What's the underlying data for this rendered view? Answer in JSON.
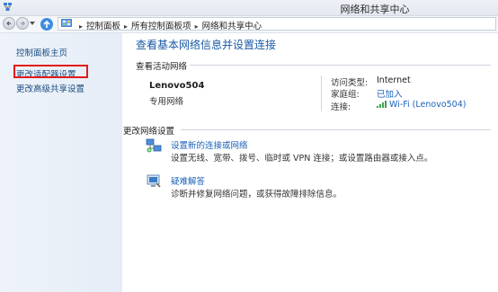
{
  "window": {
    "title": "网络和共享中心"
  },
  "breadcrumb": {
    "items": [
      "控制面板",
      "所有控制面板项",
      "网络和共享中心"
    ]
  },
  "sidebar": {
    "items": [
      {
        "label": "控制面板主页"
      },
      {
        "label": "更改适配器设置"
      },
      {
        "label": "更改高级共享设置"
      }
    ]
  },
  "main": {
    "title": "查看基本网络信息并设置连接",
    "active_networks_label": "查看活动网络",
    "network": {
      "name": "Lenovo504",
      "type": "专用网络",
      "access_type_label": "访问类型:",
      "access_type_value": "Internet",
      "homegroup_label": "家庭组:",
      "homegroup_value": "已加入",
      "connection_label": "连接:",
      "connection_value": "Wi-Fi (Lenovo504)"
    },
    "change_settings_label": "更改网络设置",
    "tasks": [
      {
        "link": "设置新的连接或网络",
        "desc": "设置无线、宽带、拨号、临时或 VPN 连接；或设置路由器或接入点。",
        "icon": "new-connection-icon"
      },
      {
        "link": "疑难解答",
        "desc": "诊断并修复网络问题，或获得故障排除信息。",
        "icon": "troubleshoot-icon"
      }
    ]
  },
  "colors": {
    "link": "#1a62b8",
    "title": "#1a5aa5",
    "highlight": "#e21b1b"
  }
}
